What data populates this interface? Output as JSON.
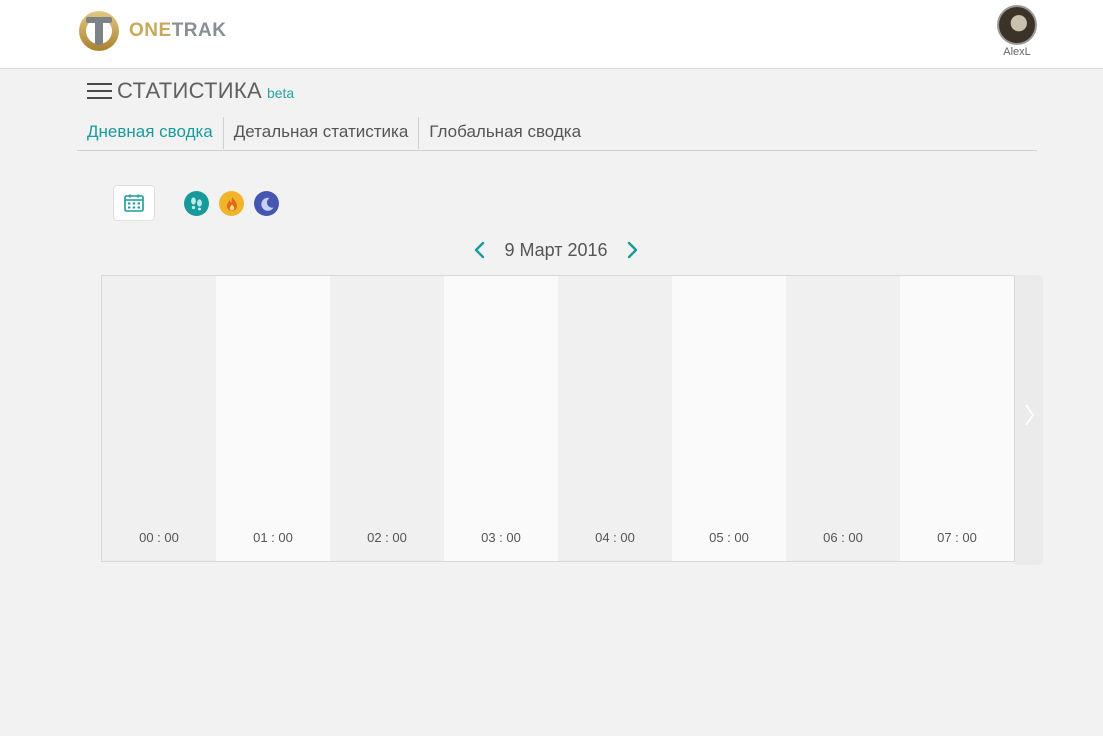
{
  "header": {
    "logo_one": "ONE",
    "logo_trak": "TRAK",
    "user_name": "AlexL"
  },
  "page": {
    "title": "СТАТИСТИКА",
    "badge": "beta"
  },
  "tabs": [
    {
      "label": "Дневная сводка",
      "active": true
    },
    {
      "label": "Детальная статистика",
      "active": false
    },
    {
      "label": "Глобальная сводка",
      "active": false
    }
  ],
  "toolbar": {
    "calendar_icon": "calendar-icon",
    "steps_icon": "footprints-icon",
    "calories_icon": "flame-icon",
    "sleep_icon": "moon-icon"
  },
  "date_nav": {
    "date": "9 Март 2016"
  },
  "timeline": {
    "hours": [
      "00 : 00",
      "01 : 00",
      "02 : 00",
      "03 : 00",
      "04 : 00",
      "05 : 00",
      "06 : 00",
      "07 : 00"
    ]
  },
  "colors": {
    "accent": "#1a9b9b",
    "steps": "#169a9a",
    "calories": "#f0b52a",
    "sleep": "#4656b0"
  }
}
